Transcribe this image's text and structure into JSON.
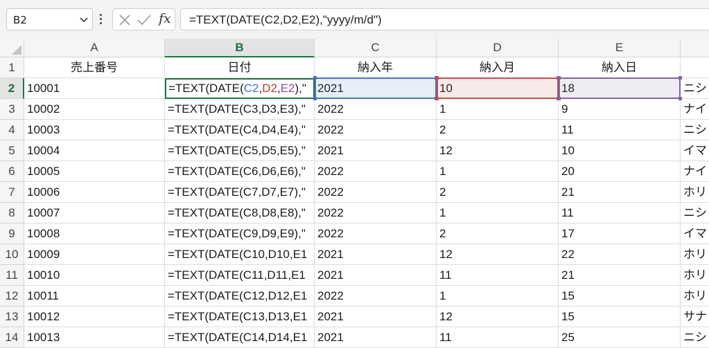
{
  "name_box": {
    "value": "B2"
  },
  "formula_bar": {
    "fx_label": "fx",
    "formula": "=TEXT(DATE(C2,D2,E2),\"yyyy/m/d\")"
  },
  "columns": [
    "A",
    "B",
    "C",
    "D",
    "E",
    ""
  ],
  "selected_column": "B",
  "selected_row": 2,
  "active_cell": "B2",
  "reference_colors": {
    "C": "#4472c4",
    "D": "#c0504d",
    "E": "#8064a2"
  },
  "rows": [
    {
      "num": "1",
      "cells": [
        "売上番号",
        "日付",
        "納入年",
        "納入月",
        "納入日",
        ""
      ]
    },
    {
      "num": "2",
      "cells": [
        "10001",
        "=TEXT(DATE(C2,D2,E2),\"yyyy/m/d\")",
        "2021",
        "10",
        "18",
        "ニシ"
      ]
    },
    {
      "num": "3",
      "cells": [
        "10002",
        "=TEXT(DATE(C3,D3,E3),\"",
        "2022",
        "1",
        "9",
        "ナイ"
      ]
    },
    {
      "num": "4",
      "cells": [
        "10003",
        "=TEXT(DATE(C4,D4,E4),\"",
        "2022",
        "2",
        "11",
        "ニシ"
      ]
    },
    {
      "num": "5",
      "cells": [
        "10004",
        "=TEXT(DATE(C5,D5,E5),\"",
        "2021",
        "12",
        "10",
        "イマ"
      ]
    },
    {
      "num": "6",
      "cells": [
        "10005",
        "=TEXT(DATE(C6,D6,E6),\"",
        "2022",
        "1",
        "20",
        "ナイ"
      ]
    },
    {
      "num": "7",
      "cells": [
        "10006",
        "=TEXT(DATE(C7,D7,E7),\"",
        "2022",
        "2",
        "21",
        "ホリ"
      ]
    },
    {
      "num": "8",
      "cells": [
        "10007",
        "=TEXT(DATE(C8,D8,E8),\"",
        "2022",
        "1",
        "11",
        "ニシ"
      ]
    },
    {
      "num": "9",
      "cells": [
        "10008",
        "=TEXT(DATE(C9,D9,E9),\"",
        "2022",
        "2",
        "17",
        "イマ"
      ]
    },
    {
      "num": "10",
      "cells": [
        "10009",
        "=TEXT(DATE(C10,D10,E1",
        "2021",
        "12",
        "22",
        "ホリ"
      ]
    },
    {
      "num": "11",
      "cells": [
        "10010",
        "=TEXT(DATE(C11,D11,E1",
        "2021",
        "11",
        "21",
        "ホリ"
      ]
    },
    {
      "num": "12",
      "cells": [
        "10011",
        "=TEXT(DATE(C12,D12,E1",
        "2022",
        "1",
        "15",
        "ホリ"
      ]
    },
    {
      "num": "13",
      "cells": [
        "10012",
        "=TEXT(DATE(C13,D13,E1",
        "2021",
        "12",
        "15",
        "サナ"
      ]
    },
    {
      "num": "14",
      "cells": [
        "10013",
        "=TEXT(DATE(C14,D14,E1",
        "2021",
        "11",
        "25",
        "ニシ"
      ]
    }
  ],
  "b2_formula_parts": {
    "prefix": "=TEXT(DATE(",
    "ref1": "C2",
    "sep1": ",",
    "ref2": "D2",
    "sep2": ",",
    "ref3": "E2",
    "suffix": "),\""
  },
  "icons": [
    "chevron-down-icon",
    "more-vertical-icon",
    "cancel-icon",
    "enter-check-icon",
    "insert-function-icon",
    "select-all-icon"
  ]
}
